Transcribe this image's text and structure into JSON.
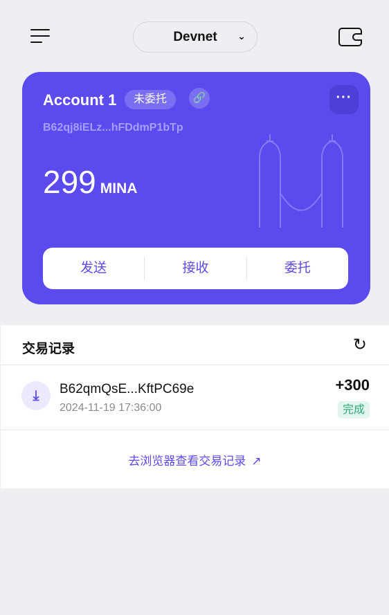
{
  "header": {
    "network": "Devnet"
  },
  "account": {
    "name": "Account 1",
    "delegation_badge": "未委托",
    "address": "B62qj8iELz...hFDdmP1bTp",
    "balance": "299",
    "unit": "MINA"
  },
  "actions": {
    "send": "发送",
    "receive": "接收",
    "delegate": "委托"
  },
  "transactions": {
    "title": "交易记录",
    "items": [
      {
        "address": "B62qmQsE...KftPC69e",
        "time": "2024-11-19 17:36:00",
        "amount": "+300",
        "status": "完成"
      }
    ],
    "view_explorer": "去浏览器查看交易记录"
  },
  "colors": {
    "accent": "#5b4bef",
    "success": "#2ca878"
  }
}
